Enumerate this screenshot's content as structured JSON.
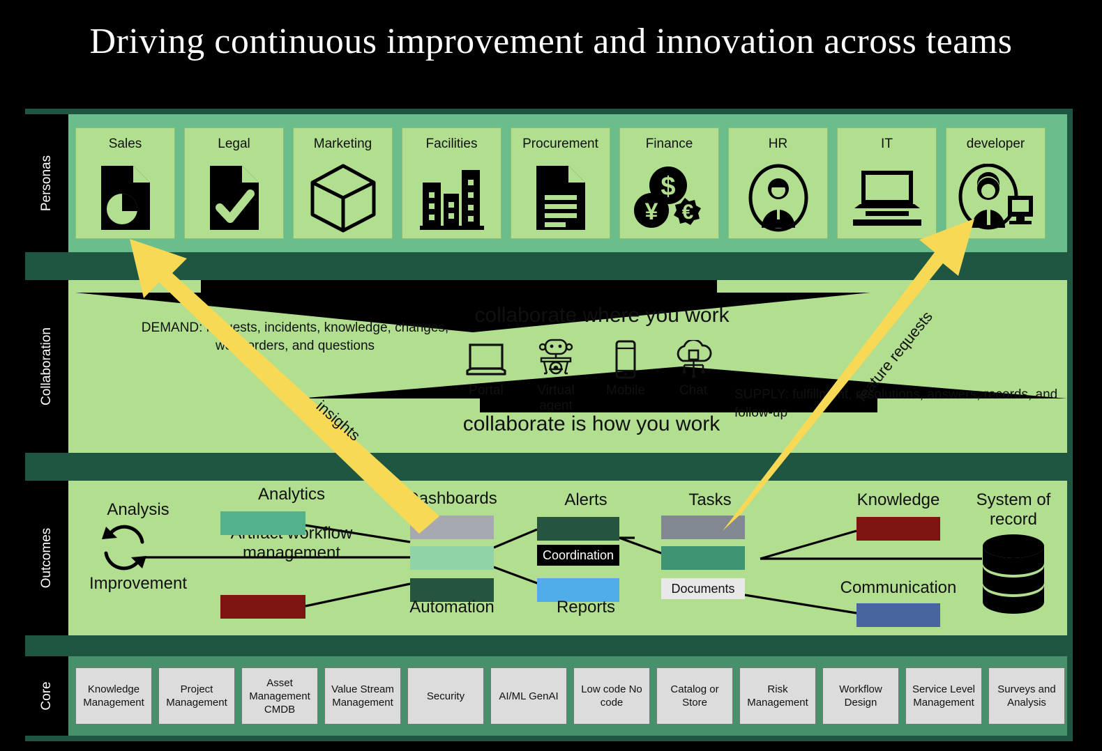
{
  "title": "Driving continuous improvement and innovation across teams",
  "bands": {
    "personas_label": "Personas",
    "collaboration_label": "Collaboration",
    "outcomes_label": "Outcomes",
    "core_label": "Core"
  },
  "personas": [
    {
      "label": "Sales",
      "icon": "document-pie-chart-icon"
    },
    {
      "label": "Legal",
      "icon": "document-check-icon"
    },
    {
      "label": "Marketing",
      "icon": "cube-box-icon"
    },
    {
      "label": "Facilities",
      "icon": "buildings-icon"
    },
    {
      "label": "Procurement",
      "icon": "document-lines-icon"
    },
    {
      "label": "Finance",
      "icon": "currency-coins-icon"
    },
    {
      "label": "HR",
      "icon": "person-portrait-icon"
    },
    {
      "label": "IT",
      "icon": "laptop-icon"
    },
    {
      "label": "developer",
      "icon": "person-monitor-icon"
    }
  ],
  "collaboration": {
    "demand_text": "DEMAND: requests, incidents, knowledge, changes, work orders, and questions",
    "supply_text": "SUPPLY: fulfillment, resolutions, answers, records, and follow-up",
    "heading_top": "collaborate where you work",
    "heading_bottom": "collaborate is how you work",
    "channels": [
      {
        "label": "Portal",
        "icon": "laptop-icon"
      },
      {
        "label": "Virtual agent",
        "icon": "robot-icon"
      },
      {
        "label": "Mobile",
        "icon": "mobile-phone-icon"
      },
      {
        "label": "Chat",
        "icon": "cloud-network-icon"
      }
    ]
  },
  "outcomes": {
    "cycle": {
      "top_label": "Analysis",
      "bottom_label": "Improvement",
      "icon": "circular-arrows-icon"
    },
    "center_label": "Artifact workflow management",
    "system_of_record": {
      "label": "System of record",
      "icon": "database-icon"
    },
    "nodes": [
      {
        "name": "analytics",
        "label": "Analytics",
        "color": "#53b18c",
        "label_pos": "top"
      },
      {
        "name": "improvement",
        "label": "",
        "color": "#7e1512",
        "label_pos": "none"
      },
      {
        "name": "dashboards",
        "label": "Dashboards",
        "color": "#a6aab0",
        "label_pos": "top"
      },
      {
        "name": "artifact",
        "label": "",
        "color": "#8fd3a6",
        "label_pos": "none"
      },
      {
        "name": "automation",
        "label": "Automation",
        "color": "#26553f",
        "label_pos": "bottom"
      },
      {
        "name": "alerts",
        "label": "Alerts",
        "color": "#26553f",
        "label_pos": "top"
      },
      {
        "name": "coordination",
        "label": "Coordination",
        "color": "#000000",
        "label_pos": "inside"
      },
      {
        "name": "reports",
        "label": "Reports",
        "color": "#51acea",
        "label_pos": "bottom"
      },
      {
        "name": "tasks",
        "label": "Tasks",
        "color": "#828891",
        "label_pos": "top"
      },
      {
        "name": "tasks2",
        "label": "",
        "color": "#3f9473",
        "label_pos": "none"
      },
      {
        "name": "documents",
        "label": "Documents",
        "color": "#e8e8e8",
        "label_pos": "inside"
      },
      {
        "name": "knowledge",
        "label": "Knowledge",
        "color": "#7e1512",
        "label_pos": "top"
      },
      {
        "name": "communication",
        "label": "Communication",
        "color": "#49659f",
        "label_pos": "top"
      }
    ]
  },
  "core": [
    "Knowledge Management",
    "Project Management",
    "Asset Management CMDB",
    "Value Stream Management",
    "Security",
    "AI/ML GenAI",
    "Low code No code",
    "Catalog or Store",
    "Risk Management",
    "Workflow Design",
    "Service Level Management",
    "Surveys and Analysis"
  ],
  "annotations": {
    "insights_label": "insights",
    "feature_requests_label": "feature requests"
  },
  "colors": {
    "frame": "#1e5641",
    "personas_band": "#6cbd8c",
    "light_green": "#b1de8f",
    "core_band": "#46906b",
    "arrow_yellow": "#f7d955",
    "background": "#000000"
  }
}
